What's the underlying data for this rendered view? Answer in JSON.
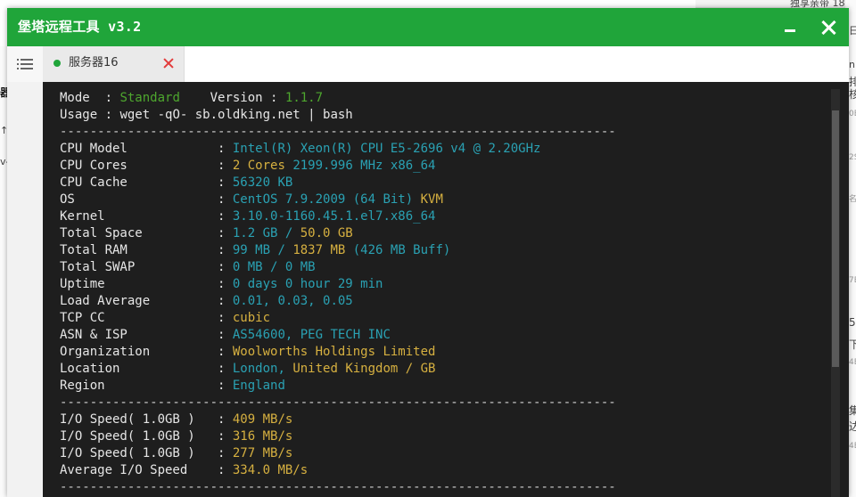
{
  "window": {
    "title": "堡塔远程工具 v3.2"
  },
  "tab": {
    "label": "服务器16"
  },
  "background": {
    "fragments": [
      "独享亲带 18",
      "日",
      "器",
      "↑",
      "v-",
      "n",
      "排",
      "核",
      "0B",
      "2S",
      "名",
      "7B",
      "5",
      "下",
      "4E",
      "集",
      "达",
      "4E"
    ]
  },
  "terminal": {
    "header": {
      "mode_label": "Mode  : ",
      "mode_value": "Standard",
      "version_label": "Version : ",
      "version_value": "1.1.7",
      "usage_label": "Usage : ",
      "usage_value": "wget -qO- sb.oldking.net | bash"
    },
    "separator": "--------------------------------------------------------------------------",
    "system": {
      "cpu_model_label": "CPU Model            : ",
      "cpu_model": "Intel(R) Xeon(R) CPU E5-2696 v4 @ 2.20GHz",
      "cpu_cores_label": "CPU Cores            : ",
      "cpu_cores_count": "2 Cores",
      "cpu_cores_freq": " 2199.996 MHz x86_64",
      "cpu_cache_label": "CPU Cache            : ",
      "cpu_cache": "56320 KB",
      "os_label": "OS                   : ",
      "os": "CentOS 7.9.2009 (64 Bit) ",
      "os_virt": "KVM",
      "kernel_label": "Kernel               : ",
      "kernel": "3.10.0-1160.45.1.el7.x86_64",
      "total_space_label": "Total Space          : ",
      "total_space_used": "1.2 GB / ",
      "total_space_total": "50.0 GB",
      "total_ram_label": "Total RAM            : ",
      "total_ram_used": "99 MB / ",
      "total_ram_total": "1837 MB",
      "total_ram_buff": " (426 MB Buff)",
      "total_swap_label": "Total SWAP           : ",
      "total_swap": "0 MB / 0 MB",
      "uptime_label": "Uptime               : ",
      "uptime": "0 days 0 hour 29 min",
      "load_label": "Load Average         : ",
      "load": "0.01, 0.03, 0.05",
      "tcp_label": "TCP CC               : ",
      "tcp": "cubic",
      "asn_label": "ASN & ISP            : ",
      "asn": "AS54600, PEG TECH INC",
      "org_label": "Organization         : ",
      "org": "Woolworths Holdings Limited",
      "location_label": "Location             : ",
      "location_city": "London, ",
      "location_country": "United Kingdom / GB",
      "region_label": "Region               : ",
      "region": "England"
    },
    "io": {
      "io1_label": "I/O Speed( 1.0GB )   : ",
      "io1": "409 MB/s",
      "io2_label": "I/O Speed( 1.0GB )   : ",
      "io2": "316 MB/s",
      "io3_label": "I/O Speed( 1.0GB )   : ",
      "io3": "277 MB/s",
      "avg_label": "Average I/O Speed    : ",
      "avg": "334.0 MB/s"
    }
  },
  "colors": {
    "titlebar": "#20a53a",
    "terminal_bg": "#1e1e1e",
    "green": "#4ea72e",
    "teal": "#2aa1b3",
    "yellow": "#d6b040",
    "status_dot": "#20a53a",
    "tab_close": "#e33b3b"
  },
  "icons": {
    "menu": "hamburger-list-icon",
    "minimize": "minimize-icon",
    "close": "close-icon",
    "tab_status": "status-dot-icon",
    "tab_close": "tab-close-icon"
  }
}
